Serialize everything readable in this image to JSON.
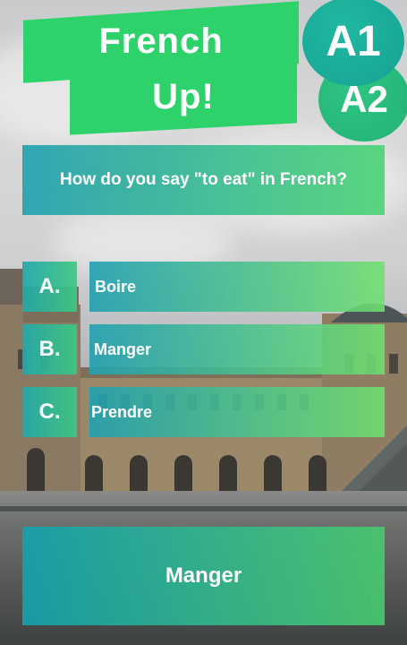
{
  "app": {
    "title_line1": "French",
    "title_line2": "Up!"
  },
  "levels": [
    "A1",
    "A2"
  ],
  "question": {
    "text": "How do you say \"to eat\" in French?"
  },
  "options": [
    {
      "letter": "A.",
      "text": "Boire"
    },
    {
      "letter": "B.",
      "text": "Manger"
    },
    {
      "letter": "C.",
      "text": "Prendre"
    }
  ],
  "answer": {
    "text": "Manger"
  },
  "colors": {
    "banner_green": "#2ed26a",
    "teal": "#20a0b0",
    "green": "#4ad474",
    "text": "#ffffff"
  }
}
